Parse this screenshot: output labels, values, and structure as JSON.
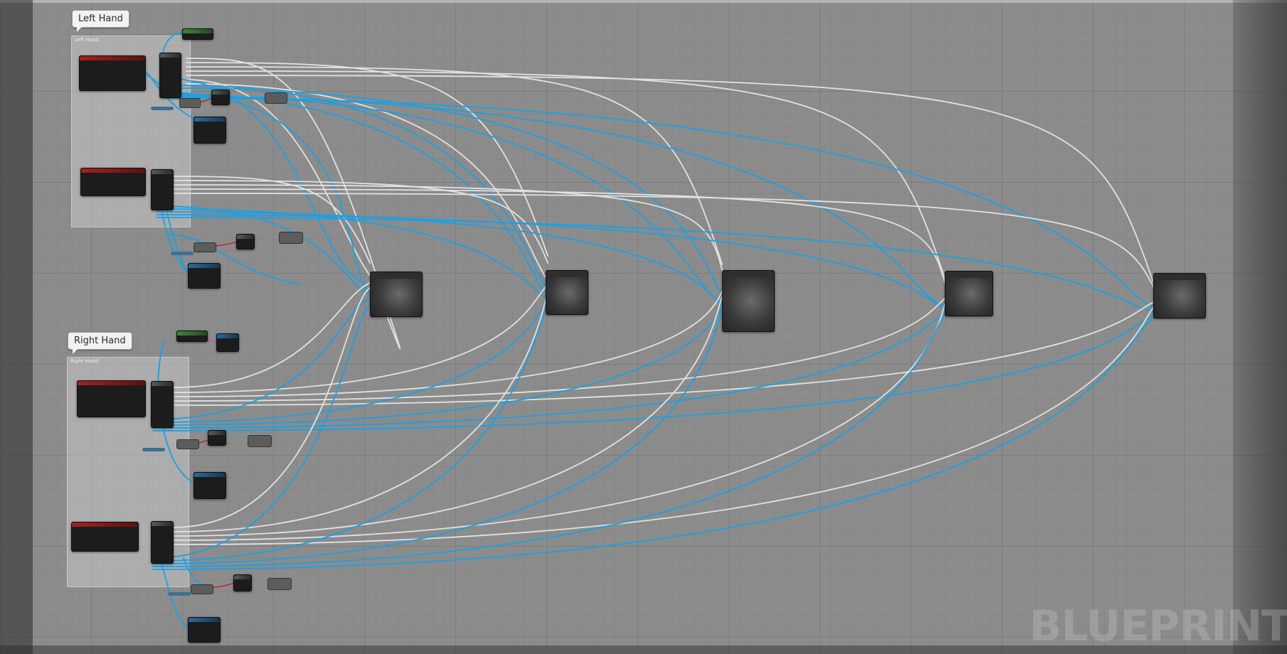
{
  "comments": {
    "left_hand": {
      "label": "Left Hand",
      "box_title": "Left Hand"
    },
    "right_hand": {
      "label": "Right Hand",
      "box_title": "Right Hand"
    }
  },
  "watermark": "BLUEPRINT",
  "colors": {
    "data_wire": "#19a0e6",
    "exec_wire": "#e8e8e8",
    "event_header": "#a6201f",
    "set_header": "#3c8a3a",
    "function_header": "#2b6a9a"
  }
}
